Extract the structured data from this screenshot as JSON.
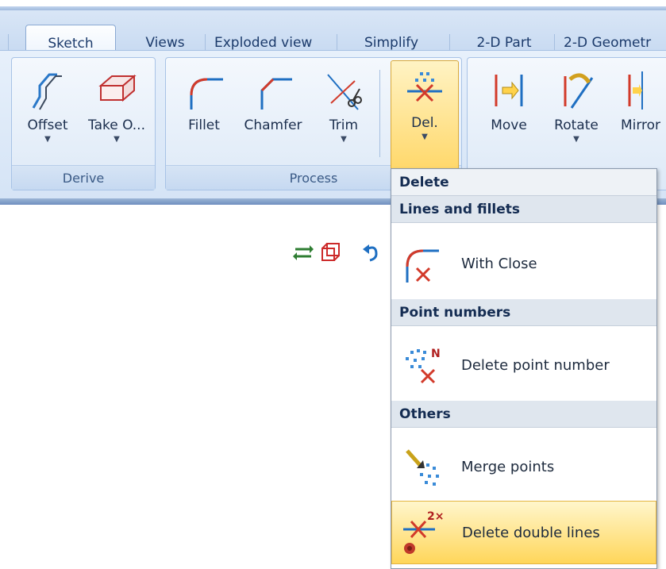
{
  "tabs": [
    {
      "label": "Sketch",
      "active": true
    },
    {
      "label": "Views"
    },
    {
      "label": "Exploded view"
    },
    {
      "label": "Simplify"
    },
    {
      "label": "2-D Part"
    },
    {
      "label": "2-D Geometr"
    }
  ],
  "groups": {
    "derive": {
      "label": "Derive",
      "buttons": [
        {
          "label": "Offset",
          "icon": "offset-icon"
        },
        {
          "label": "Take O...",
          "icon": "take-over-icon"
        }
      ]
    },
    "process": {
      "label": "Process",
      "buttons": [
        {
          "label": "Fillet",
          "icon": "fillet-icon"
        },
        {
          "label": "Chamfer",
          "icon": "chamfer-icon"
        },
        {
          "label": "Trim",
          "icon": "trim-icon"
        },
        {
          "label": "Del.",
          "icon": "delete-icon"
        }
      ]
    },
    "transform": {
      "buttons": [
        {
          "label": "Move",
          "icon": "move-icon"
        },
        {
          "label": "Rotate",
          "icon": "rotate-icon"
        },
        {
          "label": "Mirror",
          "icon": "mirror-icon"
        }
      ]
    }
  },
  "menu": {
    "title": "Delete",
    "sections": [
      {
        "header": "Lines and fillets",
        "items": [
          {
            "label": "With Close",
            "icon": "with-close-icon"
          }
        ]
      },
      {
        "header": "Point numbers",
        "items": [
          {
            "label": "Delete point number",
            "icon": "delete-point-number-icon"
          }
        ]
      },
      {
        "header": "Others",
        "items": [
          {
            "label": "Merge points",
            "icon": "merge-points-icon"
          },
          {
            "label": "Delete double lines",
            "icon": "delete-double-lines-icon",
            "highlighted": true
          }
        ]
      }
    ],
    "badges": {
      "point_number": "N",
      "double": "2×"
    }
  },
  "colors": {
    "accent": "#ffd65a",
    "ribbon": "#dbe7f6",
    "icon_red": "#d23a2a",
    "icon_blue": "#1f6fc2"
  }
}
